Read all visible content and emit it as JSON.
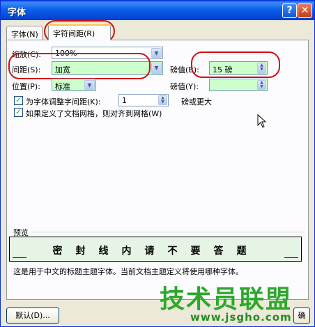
{
  "window": {
    "title": "字体",
    "help": "?",
    "close": "✕"
  },
  "tabs": [
    {
      "label": "字体(N)"
    },
    {
      "label": "字符间距(R)"
    }
  ],
  "scale": {
    "label": "缩放(C):",
    "value": "100%"
  },
  "spacing": {
    "label": "间距(S):",
    "value": "加宽",
    "by_label": "磅值(B):",
    "by_value": "15 磅"
  },
  "position": {
    "label": "位置(P):",
    "value": "标准",
    "by_label": "磅值(Y):",
    "by_value": ""
  },
  "kerning": {
    "label": "为字体调整字间距(K):",
    "value": "1",
    "suffix": "磅或更大",
    "checked": true
  },
  "grid": {
    "label": "如果定义了文档网格，则对齐到网格(W)",
    "checked": true
  },
  "preview": {
    "section_label": "预览",
    "sample": "密封线内请不要答题",
    "note": "这是用于中文的标题主题字体。当前文档主题定义将使用哪种字体。"
  },
  "buttons": {
    "default": "默认(D)...",
    "ok_partial": "确"
  },
  "watermark": {
    "brand": "技术员联盟",
    "url": "www.jsgho.com"
  },
  "colors": {
    "highlight": "#ccffcc",
    "annotation": "#d01010",
    "title_bar": "#0a5fe8"
  }
}
